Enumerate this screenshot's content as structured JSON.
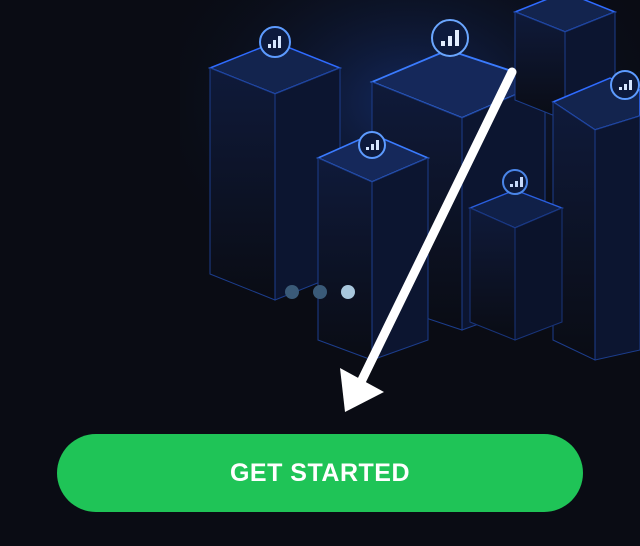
{
  "onboarding": {
    "pager": {
      "total": 3,
      "active_index": 3
    },
    "cta_label": "GET STARTED"
  },
  "colors": {
    "background": "#0a0c14",
    "accent_green": "#1fc457",
    "neon_blue": "#2f7bff"
  },
  "icons": {
    "signal": "signal-bars-icon",
    "arrow": "pointer-arrow"
  }
}
